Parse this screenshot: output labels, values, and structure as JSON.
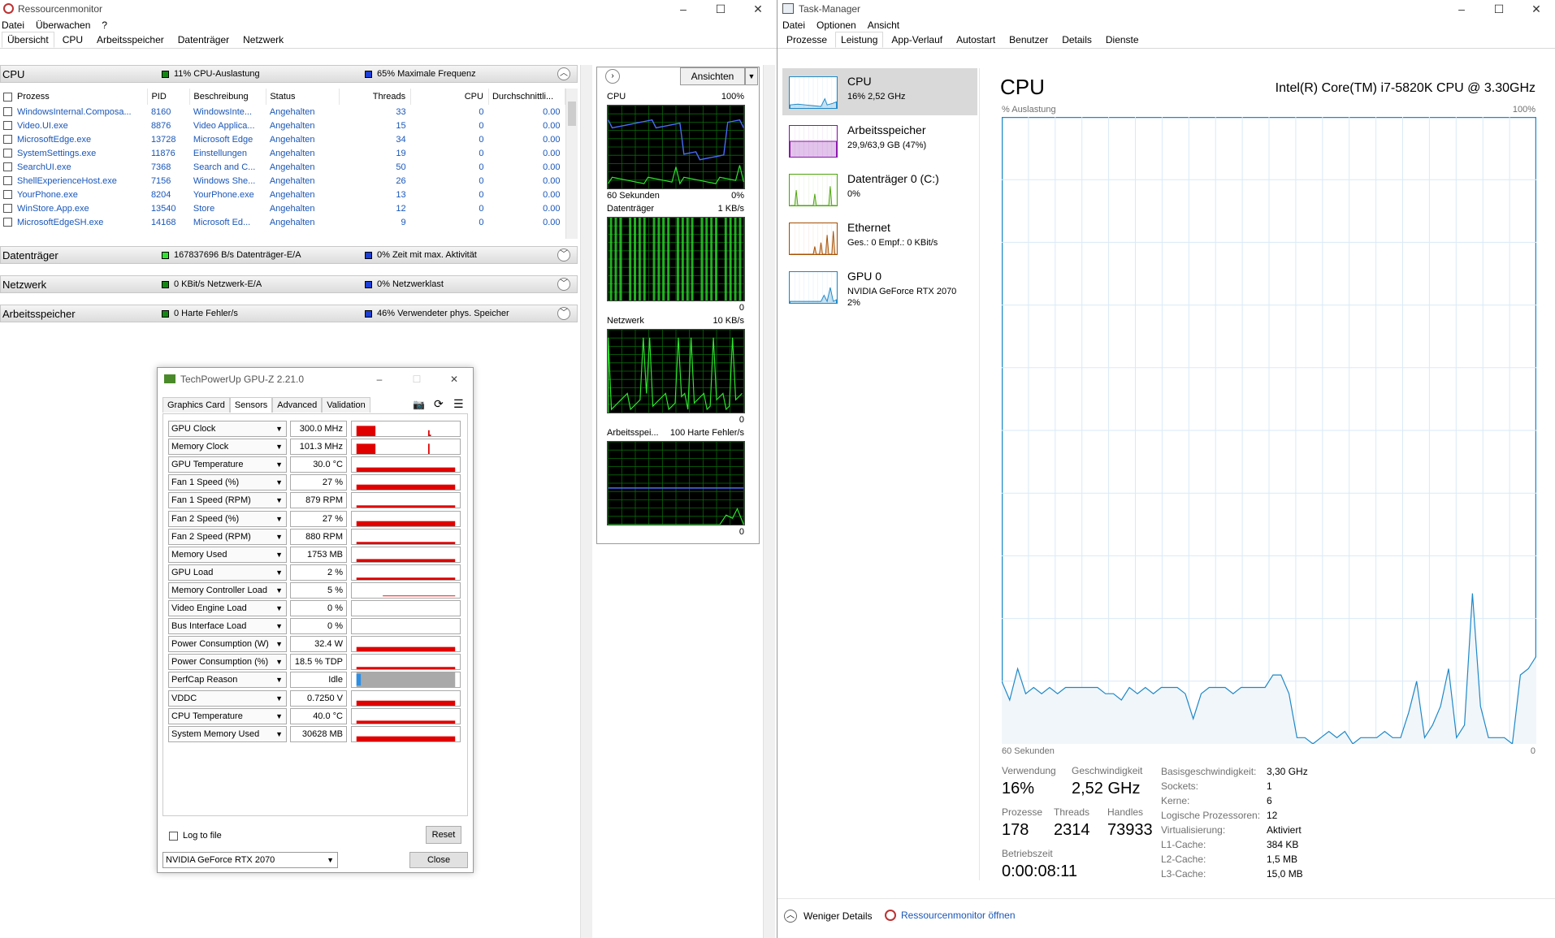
{
  "resmon": {
    "title": "Ressourcenmonitor",
    "menu": [
      "Datei",
      "Überwachen",
      "?"
    ],
    "tabs": [
      "Übersicht",
      "CPU",
      "Arbeitsspeicher",
      "Datenträger",
      "Netzwerk"
    ],
    "cpu_section": {
      "title": "CPU",
      "indicator1": "11% CPU-Auslastung",
      "indicator2": "65% Maximale Frequenz"
    },
    "columns": [
      "Prozess",
      "PID",
      "Beschreibung",
      "Status",
      "Threads",
      "CPU",
      "Durchschnittli..."
    ],
    "rows": [
      {
        "name": "WindowsInternal.Composa...",
        "pid": "8160",
        "desc": "WindowsInte...",
        "status": "Angehalten",
        "threads": "33",
        "cpu": "0",
        "avg": "0.00"
      },
      {
        "name": "Video.UI.exe",
        "pid": "8876",
        "desc": "Video Applica...",
        "status": "Angehalten",
        "threads": "15",
        "cpu": "0",
        "avg": "0.00"
      },
      {
        "name": "MicrosoftEdge.exe",
        "pid": "13728",
        "desc": "Microsoft Edge",
        "status": "Angehalten",
        "threads": "34",
        "cpu": "0",
        "avg": "0.00"
      },
      {
        "name": "SystemSettings.exe",
        "pid": "11876",
        "desc": "Einstellungen",
        "status": "Angehalten",
        "threads": "19",
        "cpu": "0",
        "avg": "0.00"
      },
      {
        "name": "SearchUI.exe",
        "pid": "7368",
        "desc": "Search and C...",
        "status": "Angehalten",
        "threads": "50",
        "cpu": "0",
        "avg": "0.00"
      },
      {
        "name": "ShellExperienceHost.exe",
        "pid": "7156",
        "desc": "Windows She...",
        "status": "Angehalten",
        "threads": "26",
        "cpu": "0",
        "avg": "0.00"
      },
      {
        "name": "YourPhone.exe",
        "pid": "8204",
        "desc": "YourPhone.exe",
        "status": "Angehalten",
        "threads": "13",
        "cpu": "0",
        "avg": "0.00"
      },
      {
        "name": "WinStore.App.exe",
        "pid": "13540",
        "desc": "Store",
        "status": "Angehalten",
        "threads": "12",
        "cpu": "0",
        "avg": "0.00"
      },
      {
        "name": "MicrosoftEdgeSH.exe",
        "pid": "14168",
        "desc": "Microsoft Ed...",
        "status": "Angehalten",
        "threads": "9",
        "cpu": "0",
        "avg": "0.00"
      }
    ],
    "disk_section": {
      "title": "Datenträger",
      "indicator1": "167837696 B/s Datenträger-E/A",
      "indicator2": "0% Zeit mit max. Aktivität"
    },
    "net_section": {
      "title": "Netzwerk",
      "indicator1": "0 KBit/s Netzwerk-E/A",
      "indicator2": "0% Netzwerklast"
    },
    "mem_section": {
      "title": "Arbeitsspeicher",
      "indicator1": "0 Harte Fehler/s",
      "indicator2": "46% Verwendeter phys. Speicher"
    },
    "graphs_pane": {
      "views_button": "Ansichten",
      "cpu": {
        "title": "CPU",
        "max": "100%",
        "footer_left": "60 Sekunden",
        "footer_right": "0%"
      },
      "disk": {
        "title": "Datenträger",
        "max": "1 KB/s",
        "footer_right": "0"
      },
      "net": {
        "title": "Netzwerk",
        "max": "10 KB/s",
        "footer_right": "0"
      },
      "mem": {
        "title": "Arbeitsspei...",
        "max": "100 Harte Fehler/s",
        "footer_right": "0"
      }
    }
  },
  "gpuz": {
    "title": "TechPowerUp GPU-Z 2.21.0",
    "tabs": [
      "Graphics Card",
      "Sensors",
      "Advanced",
      "Validation"
    ],
    "sensors": [
      {
        "name": "GPU Clock",
        "value": "300.0 MHz"
      },
      {
        "name": "Memory Clock",
        "value": "101.3 MHz"
      },
      {
        "name": "GPU Temperature",
        "value": "30.0 °C"
      },
      {
        "name": "Fan 1 Speed (%)",
        "value": "27 %"
      },
      {
        "name": "Fan 1 Speed (RPM)",
        "value": "879 RPM"
      },
      {
        "name": "Fan 2 Speed (%)",
        "value": "27 %"
      },
      {
        "name": "Fan 2 Speed (RPM)",
        "value": "880 RPM"
      },
      {
        "name": "Memory Used",
        "value": "1753 MB"
      },
      {
        "name": "GPU Load",
        "value": "2 %"
      },
      {
        "name": "Memory Controller Load",
        "value": "5 %"
      },
      {
        "name": "Video Engine Load",
        "value": "0 %"
      },
      {
        "name": "Bus Interface Load",
        "value": "0 %"
      },
      {
        "name": "Power Consumption (W)",
        "value": "32.4 W"
      },
      {
        "name": "Power Consumption (%)",
        "value": "18.5 % TDP"
      },
      {
        "name": "PerfCap Reason",
        "value": "Idle"
      },
      {
        "name": "VDDC",
        "value": "0.7250 V"
      },
      {
        "name": "CPU Temperature",
        "value": "40.0 °C"
      },
      {
        "name": "System Memory Used",
        "value": "30628 MB"
      }
    ],
    "log_label": "Log to file",
    "reset_label": "Reset",
    "device_select": "NVIDIA GeForce RTX 2070",
    "close_label": "Close"
  },
  "taskmgr": {
    "title": "Task-Manager",
    "menu": [
      "Datei",
      "Optionen",
      "Ansicht"
    ],
    "tabs": [
      "Prozesse",
      "Leistung",
      "App-Verlauf",
      "Autostart",
      "Benutzer",
      "Details",
      "Dienste"
    ],
    "nav": [
      {
        "label": "CPU",
        "sub": "16% 2,52 GHz",
        "color": "#1e88c8"
      },
      {
        "label": "Arbeitsspeicher",
        "sub": "29,9/63,9 GB (47%)",
        "color": "#8b12ae"
      },
      {
        "label": "Datenträger 0 (C:)",
        "sub": "0%",
        "color": "#4da60c"
      },
      {
        "label": "Ethernet",
        "sub": "Ges.: 0 Empf.: 0 KBit/s",
        "color": "#a74f01"
      },
      {
        "label": "GPU 0",
        "sub": "NVIDIA GeForce RTX 2070",
        "sub2": "2%",
        "color": "#1e88c8"
      }
    ],
    "cpu_heading": "CPU",
    "cpu_model": "Intel(R) Core(TM) i7-5820K CPU @ 3.30GHz",
    "graph_label": "% Auslastung",
    "graph_max": "100%",
    "graph_left": "60 Sekunden",
    "graph_right": "0",
    "usage_history": [
      10,
      7,
      12,
      8,
      9,
      8,
      9,
      8,
      9,
      9,
      9,
      9,
      9,
      8,
      8,
      7,
      9,
      8,
      9,
      8,
      9,
      9,
      9,
      8,
      4,
      8,
      9,
      9,
      9,
      8,
      9,
      9,
      9,
      9,
      11,
      11,
      8,
      1,
      1,
      0,
      1,
      2,
      1,
      2,
      0,
      1,
      1,
      1,
      2,
      1,
      1,
      5,
      10,
      1,
      3,
      6,
      12,
      1,
      3,
      24,
      6,
      1,
      1,
      1,
      0,
      11,
      12,
      14
    ],
    "stats": {
      "verwendung_label": "Verwendung",
      "verwendung": "16%",
      "geschw_label": "Geschwindigkeit",
      "geschw": "2,52 GHz",
      "prozesse_label": "Prozesse",
      "prozesse": "178",
      "threads_label": "Threads",
      "threads": "2314",
      "handles_label": "Handles",
      "handles": "73933",
      "betrieb_label": "Betriebszeit",
      "betrieb": "0:00:08:11"
    },
    "details": [
      {
        "k": "Basisgeschwindigkeit:",
        "v": "3,30 GHz"
      },
      {
        "k": "Sockets:",
        "v": "1"
      },
      {
        "k": "Kerne:",
        "v": "6"
      },
      {
        "k": "Logische Prozessoren:",
        "v": "12"
      },
      {
        "k": "Virtualisierung:",
        "v": "Aktiviert"
      },
      {
        "k": "L1-Cache:",
        "v": "384 KB"
      },
      {
        "k": "L2-Cache:",
        "v": "1,5 MB"
      },
      {
        "k": "L3-Cache:",
        "v": "15,0 MB"
      }
    ],
    "footer_less": "Weniger Details",
    "footer_resmon": "Ressourcenmonitor öffnen"
  }
}
